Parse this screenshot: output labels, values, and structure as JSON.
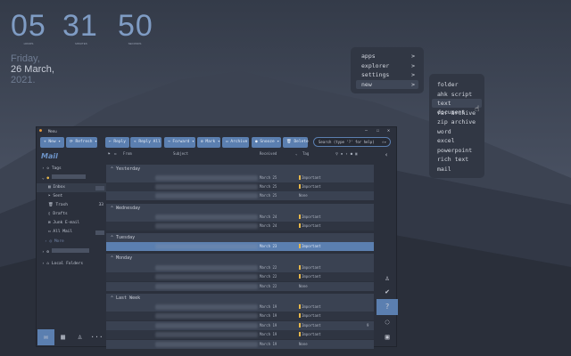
{
  "clock": {
    "hours": "05",
    "minutes": "31",
    "seconds": "50",
    "hours_label": "HOURS",
    "minutes_label": "MINUTES",
    "seconds_label": "SECONDS",
    "day": "Friday,",
    "date": "26 March,",
    "year": "2021."
  },
  "menu": {
    "items": [
      "apps",
      "explorer",
      "settings",
      "new"
    ],
    "chevron": ">"
  },
  "submenu": {
    "items": [
      "folder",
      "ahk script",
      "text document",
      "rar archive",
      "zip archive",
      "word",
      "excel",
      "powerpoint",
      "rich text",
      "mail"
    ]
  },
  "window": {
    "title": "Menu",
    "min": "–",
    "max": "☐",
    "close": "✕"
  },
  "toolbar": {
    "new": "New",
    "refresh": "Refresh",
    "reply": "Reply",
    "reply_all": "Reply All",
    "forward": "Forward",
    "mark": "Mark",
    "archive": "Archive",
    "snooze": "Snooze",
    "delete": "Delete",
    "search_placeholder": "Search (type '?' for help)"
  },
  "sidebar": {
    "title": "Mail",
    "tags": "Tags",
    "inbox": "Inbox",
    "sent": "Sent",
    "trash": "Trash",
    "trash_count": "33",
    "drafts": "Drafts",
    "junk": "Junk E-mail",
    "all_mail": "All Mail",
    "more": "More",
    "local": "Local Folders"
  },
  "columns": {
    "from": "From",
    "subject": "Subject",
    "received": "Received",
    "tag": "Tag"
  },
  "groups": [
    {
      "label": "Yesterday",
      "rows": [
        {
          "date": "March 25",
          "tag": "Important"
        },
        {
          "date": "March 25",
          "tag": "Important"
        },
        {
          "date": "March 25",
          "tag": "None"
        }
      ]
    },
    {
      "label": "Wednesday",
      "rows": [
        {
          "date": "March 24",
          "tag": "Important"
        },
        {
          "date": "March 24",
          "tag": "Important"
        }
      ]
    },
    {
      "label": "Tuesday",
      "rows": [
        {
          "date": "March 23",
          "tag": "Important"
        }
      ]
    },
    {
      "label": "Monday",
      "rows": [
        {
          "date": "March 22",
          "tag": "Important"
        },
        {
          "date": "March 22",
          "tag": "Important"
        },
        {
          "date": "March 22",
          "tag": "None"
        }
      ]
    },
    {
      "label": "Last Week",
      "rows": [
        {
          "date": "March 19",
          "tag": "Important"
        },
        {
          "date": "March 19",
          "tag": "Important"
        },
        {
          "date": "March 19",
          "tag": "Important",
          "count": "9"
        },
        {
          "date": "March 19",
          "tag": "Important"
        },
        {
          "date": "March 19",
          "tag": "None"
        }
      ]
    }
  ],
  "colors": {
    "accent": "#5b7fb0",
    "flag": "#e8b84a"
  }
}
